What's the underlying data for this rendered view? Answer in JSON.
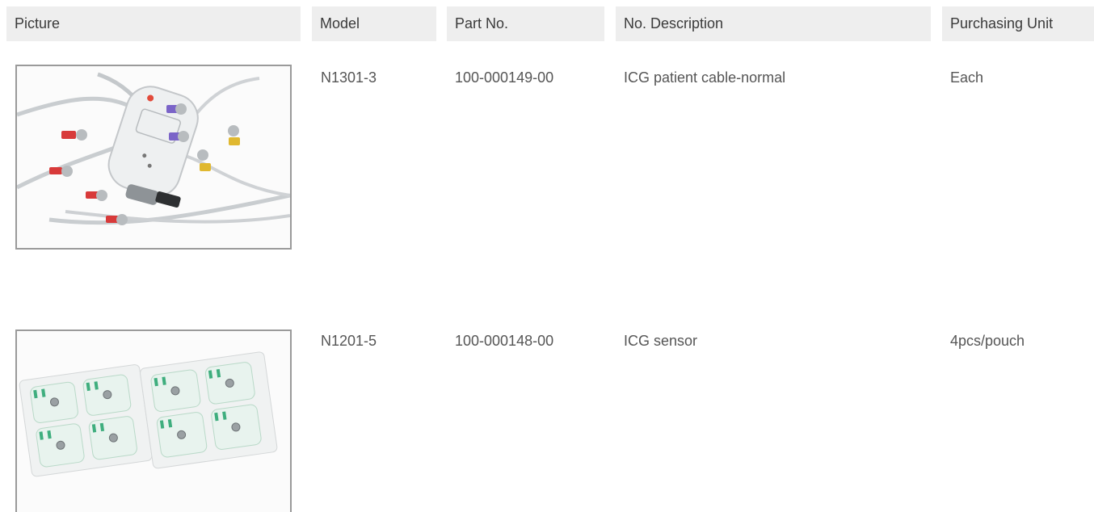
{
  "table": {
    "headers": {
      "picture": "Picture",
      "model": "Model",
      "part_no": "Part No.",
      "description": "No. Description",
      "unit": "Purchasing Unit"
    },
    "rows": [
      {
        "image_icon": "icg-patient-cable-photo",
        "model": "N1301-3",
        "part_no": "100-000149-00",
        "description": "ICG patient cable-normal",
        "unit": "Each"
      },
      {
        "image_icon": "icg-sensor-pads-photo",
        "model": "N1201-5",
        "part_no": "100-000148-00",
        "description": "ICG sensor",
        "unit": "4pcs/pouch"
      }
    ]
  }
}
